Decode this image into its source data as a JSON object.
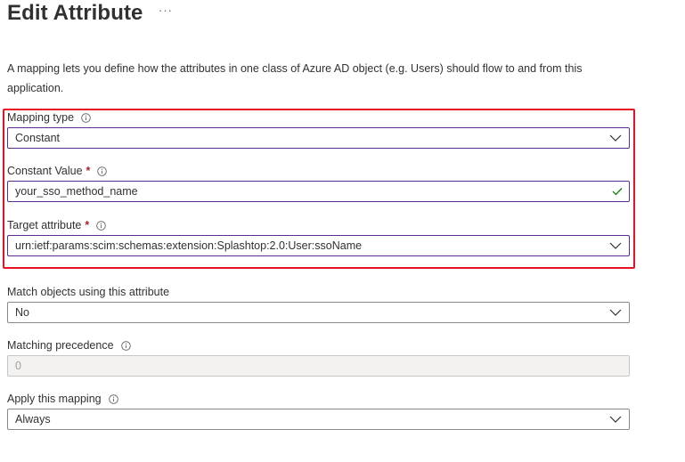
{
  "header": {
    "title": "Edit Attribute",
    "more": "···"
  },
  "description": "A mapping lets you define how the attributes in one class of Azure AD object (e.g. Users) should flow to and from this application.",
  "fields": {
    "mapping_type": {
      "label": "Mapping type",
      "value": "Constant"
    },
    "constant_value": {
      "label": "Constant Value",
      "required_mark": "*",
      "value": "your_sso_method_name"
    },
    "target_attribute": {
      "label": "Target attribute",
      "required_mark": "*",
      "value": "urn:ietf:params:scim:schemas:extension:Splashtop:2.0:User:ssoName"
    },
    "match_objects": {
      "label": "Match objects using this attribute",
      "value": "No"
    },
    "matching_precedence": {
      "label": "Matching precedence",
      "value": "0"
    },
    "apply_mapping": {
      "label": "Apply this mapping",
      "value": "Always"
    }
  },
  "colors": {
    "highlight_border": "#e81123",
    "required": "#a4262c",
    "valid_check": "#107c10",
    "active_border": "#5b2d91"
  },
  "icons": {
    "info": "info-circle-icon",
    "dropdown": "chevron-down-icon",
    "valid": "checkmark-icon",
    "more": "more-ellipsis-icon"
  }
}
